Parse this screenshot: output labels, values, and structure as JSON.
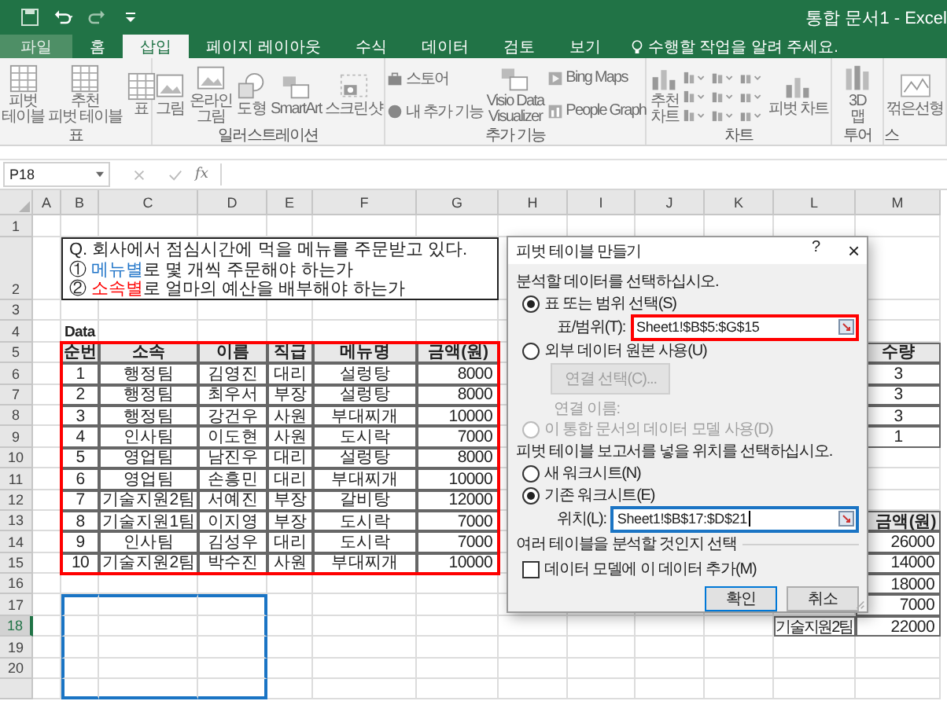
{
  "title_bar": {
    "title": "통합 문서1 - Excel"
  },
  "tabs": [
    {
      "label": "파일",
      "kind": "file",
      "selected": false
    },
    {
      "label": "홈",
      "kind": "tab",
      "selected": false
    },
    {
      "label": "삽입",
      "kind": "tab",
      "selected": true
    },
    {
      "label": "페이지 레이아웃",
      "kind": "tab",
      "selected": false
    },
    {
      "label": "수식",
      "kind": "tab",
      "selected": false
    },
    {
      "label": "데이터",
      "kind": "tab",
      "selected": false
    },
    {
      "label": "검토",
      "kind": "tab",
      "selected": false
    },
    {
      "label": "보기",
      "kind": "tab",
      "selected": false
    }
  ],
  "tell_me": {
    "text": "수행할 작업을 알려 주세요."
  },
  "ribbon": {
    "groups": [
      {
        "label": "표",
        "columns": [
          [
            {
              "label": "피벗\n테이블",
              "kind": "large"
            }
          ],
          [
            {
              "label": "추천\n피벗 테이블",
              "kind": "large"
            }
          ],
          [
            {
              "label": "표",
              "kind": "large"
            }
          ]
        ]
      },
      {
        "label": "일러스트레이션",
        "columns": [
          [
            {
              "label": "그림",
              "kind": "large"
            }
          ],
          [
            {
              "label": "온라인\n그림",
              "kind": "large"
            }
          ],
          [
            {
              "label": "도형",
              "kind": "large"
            }
          ],
          [
            {
              "label": "SmartArt",
              "kind": "large"
            }
          ],
          [
            {
              "label": "스크린샷",
              "kind": "large"
            }
          ]
        ]
      },
      {
        "label": "추가 기능",
        "columns": [
          [
            {
              "label": "스토어",
              "kind": "small"
            },
            {
              "label": "내 추가 기능",
              "kind": "small"
            }
          ],
          [
            {
              "label": "Visio Data\nVisualizer",
              "kind": "large"
            }
          ],
          [
            {
              "label": "Bing Maps",
              "kind": "small"
            },
            {
              "label": "People Graph",
              "kind": "small"
            }
          ]
        ]
      },
      {
        "label": "차트",
        "columns": [
          [
            {
              "label": "추천\n차트",
              "kind": "large"
            }
          ],
          [
            {
              "kind": "gallery"
            }
          ],
          [
            {
              "label": "피벗 차트",
              "kind": "large"
            }
          ]
        ]
      },
      {
        "label": "투어",
        "columns": [
          [
            {
              "label": "3D\n맵",
              "kind": "large"
            }
          ]
        ]
      },
      {
        "label": "스",
        "columns": [
          [
            {
              "label": "꺾은선형",
              "kind": "large"
            }
          ]
        ]
      }
    ]
  },
  "formula_bar": {
    "name_box": "P18",
    "function_label": "fx"
  },
  "sheet": {
    "columns": [
      "A",
      "B",
      "C",
      "D",
      "E",
      "F",
      "G",
      "H",
      "I",
      "J",
      "K",
      "L",
      "M"
    ],
    "rows": [
      {
        "label": "1",
        "selected": false
      },
      {
        "label": "2",
        "selected": false
      },
      {
        "label": "3",
        "selected": false
      },
      {
        "label": "4",
        "selected": false
      },
      {
        "label": "5",
        "selected": false
      },
      {
        "label": "6",
        "selected": false
      },
      {
        "label": "7",
        "selected": false
      },
      {
        "label": "8",
        "selected": false
      },
      {
        "label": "9",
        "selected": false
      },
      {
        "label": "10",
        "selected": false
      },
      {
        "label": "11",
        "selected": false
      },
      {
        "label": "12",
        "selected": false
      },
      {
        "label": "13",
        "selected": false
      },
      {
        "label": "14",
        "selected": false
      },
      {
        "label": "15",
        "selected": false
      },
      {
        "label": "16",
        "selected": false
      },
      {
        "label": "17",
        "selected": false
      },
      {
        "label": "18",
        "selected": true
      },
      {
        "label": "19",
        "selected": false
      },
      {
        "label": "20",
        "selected": false
      }
    ],
    "question": [
      {
        "text": "Q. 회사에서 점심시간에 먹을 메뉴를 주문받고 있다."
      },
      {
        "marker": "①",
        "highlight": "메뉴별",
        "rest": "로 몇 개씩 주문해야 하는가",
        "color": "#1f74c8"
      },
      {
        "marker": "②",
        "highlight": "소속별",
        "rest": "로 얼마의 예산을 배부해야 하는가",
        "color": "#ff0000"
      }
    ],
    "data_title": "Data",
    "data_table": {
      "columns": [
        "순번",
        "소속",
        "이름",
        "직급",
        "메뉴명",
        "금액(원)"
      ],
      "rows": [
        [
          "1",
          "행정팀",
          "김영진",
          "대리",
          "설렁탕",
          "8000"
        ],
        [
          "2",
          "행정팀",
          "최우서",
          "부장",
          "설렁탕",
          "8000"
        ],
        [
          "3",
          "행정팀",
          "강건우",
          "사원",
          "부대찌개",
          "10000"
        ],
        [
          "4",
          "인사팀",
          "이도현",
          "사원",
          "도시락",
          "7000"
        ],
        [
          "5",
          "영업팀",
          "남진우",
          "대리",
          "설렁탕",
          "8000"
        ],
        [
          "6",
          "영업팀",
          "손흥민",
          "대리",
          "부대찌개",
          "10000"
        ],
        [
          "7",
          "기술지원2팀",
          "서예진",
          "부장",
          "갈비탕",
          "12000"
        ],
        [
          "8",
          "기술지원1팀",
          "이지영",
          "부장",
          "도시락",
          "7000"
        ],
        [
          "9",
          "인사팀",
          "김성우",
          "대리",
          "도시락",
          "7000"
        ],
        [
          "10",
          "기술지원2팀",
          "박수진",
          "사원",
          "부대찌개",
          "10000"
        ]
      ]
    },
    "menu_count": {
      "header": "수량",
      "values": [
        "3",
        "3",
        "3",
        "1"
      ]
    },
    "team_amount": {
      "header": "금액(원)",
      "rows": [
        {
          "amount": "26000"
        },
        {
          "amount": "14000"
        },
        {
          "amount": "18000"
        },
        {
          "amount": "7000"
        },
        {
          "team": "기술지원2팀",
          "amount": "22000"
        }
      ]
    }
  },
  "dialog": {
    "title": "피벗 테이블 만들기",
    "help": "?",
    "close": "×",
    "source_heading": "분석할 데이터를 선택하십시오.",
    "source_options": [
      {
        "label": "표 또는 범위 선택(S)",
        "selected": true,
        "disabled": false
      },
      {
        "label": "외부 데이터 원본 사용(U)",
        "selected": false,
        "disabled": false
      },
      {
        "label": "이 통합 문서의 데이터 모델 사용(D)",
        "selected": false,
        "disabled": true
      }
    ],
    "range_field": {
      "label": "표/범위(T):",
      "value": "Sheet1!$B$5:$G$15"
    },
    "connection_button": {
      "label": "연결 선택(C)...",
      "disabled": true
    },
    "connection_name": {
      "label": "연결 이름:",
      "disabled": true
    },
    "target_heading": "피벗 테이블 보고서를 넣을 위치를 선택하십시오.",
    "target_options": [
      {
        "label": "새 워크시트(N)",
        "selected": false
      },
      {
        "label": "기존 워크시트(E)",
        "selected": true
      }
    ],
    "location_field": {
      "label": "위치(L):",
      "value": "Sheet1!$B$17:$D$21"
    },
    "multi_heading": "여러 테이블을 분석할 것인지 선택",
    "model_checkbox": {
      "label": "데이터 모델에 이 데이터 추가(M)",
      "checked": false
    },
    "buttons": [
      {
        "label": "확인",
        "default": true
      },
      {
        "label": "취소",
        "default": false
      }
    ]
  }
}
